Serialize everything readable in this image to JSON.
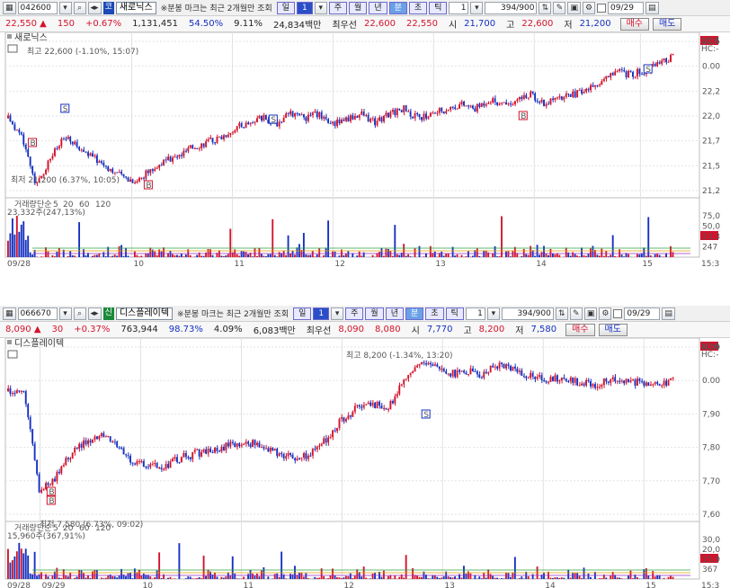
{
  "colors": {
    "up": "#d3132b",
    "down": "#1530c0",
    "grid": "#e2e2e2",
    "ma5": "#9a30c8",
    "ma20": "#e0a000",
    "ma60": "#2aa040",
    "ma120": "#888888"
  },
  "panels": [
    {
      "toolbar": {
        "code": "042600",
        "market_tag": "코",
        "name": "새로닉스",
        "note": "※분봉 마크는 최근 2개월만 조회",
        "periods": [
          "일",
          "1",
          "주",
          "월",
          "년",
          "분",
          "초",
          "틱"
        ],
        "interval": "1",
        "count": "394/900",
        "date": "09/29"
      },
      "quote": {
        "price": "22,550",
        "change": "150",
        "change_pct": "+0.67%",
        "volume": "1,131,451",
        "vol_ratio": "54.50%",
        "turnover": "9.11%",
        "amount": "24,834백만",
        "best_label": "최우선",
        "ask": "22,600",
        "bid": "22,550",
        "open_label": "시",
        "open": "21,700",
        "high_label": "고",
        "high": "22,600",
        "low_label": "저",
        "low": "21,200",
        "buy": "매수",
        "sell": "매도"
      },
      "chart_data": {
        "type": "candlestick",
        "stock_label": "새로닉스",
        "high_note": "최고 22,600 (-1.10%, 15:07)",
        "low_note": "최저 21,200 (6.37%, 10:05)",
        "price_ticks": [
          "22,5",
          "0.00",
          "22,2",
          "22,0",
          "21,7",
          "21,5",
          "21,2"
        ],
        "lc_label": "LC:6",
        "hc_label": "HC:-",
        "vol_legend": [
          "거래량",
          "단순",
          "5",
          "20",
          "60",
          "120"
        ],
        "vol_value": "23,332주(247,13%)",
        "vol_ticks": [
          "75,0",
          "50,0",
          "23,3",
          "247"
        ],
        "x_labels": [
          "09/28",
          "10",
          "11",
          "12",
          "13",
          "14",
          "15",
          "15:3"
        ],
        "path": [
          21900,
          21700,
          21200,
          21500,
          21700,
          21600,
          21500,
          21400,
          21300,
          21250,
          21350,
          21450,
          21500,
          21600,
          21650,
          21700,
          21800,
          21850,
          21900,
          21850,
          21950,
          21900,
          21950,
          21850,
          21900,
          21950,
          21850,
          21950,
          22000,
          21900,
          21950,
          22000,
          22050,
          22000,
          22100,
          22050,
          22100,
          22150,
          22050,
          22100,
          22150,
          22200,
          22300,
          22400,
          22350,
          22400,
          22450,
          22550
        ]
      }
    },
    {
      "toolbar": {
        "code": "066670",
        "market_tag": "신",
        "name": "디스플레이텍",
        "note": "※분봉 마크는 최근 2개월만 조회",
        "periods": [
          "일",
          "1",
          "주",
          "월",
          "년",
          "분",
          "초",
          "틱"
        ],
        "interval": "1",
        "count": "394/900",
        "date": "09/29"
      },
      "quote": {
        "price": "8,090",
        "change": "30",
        "change_pct": "+0.37%",
        "volume": "763,944",
        "vol_ratio": "98.73%",
        "turnover": "4.09%",
        "amount": "6,083백만",
        "best_label": "최우선",
        "ask": "8,090",
        "bid": "8,080",
        "open_label": "시",
        "open": "7,770",
        "high_label": "고",
        "high": "8,200",
        "low_label": "저",
        "low": "7,580",
        "buy": "매수",
        "sell": "매도"
      },
      "chart_data": {
        "type": "candlestick",
        "stock_label": "디스플레이텍",
        "high_note": "최고 8,200 (-1.34%, 13:20)",
        "low_note": "최저 7,580 (6.73%, 09:02)",
        "price_ticks": [
          "8,09",
          "0.00",
          "7,90",
          "7,80",
          "7,70",
          "7,60"
        ],
        "lc_label": "LC:6",
        "hc_label": "HC:-",
        "vol_legend": [
          "거래량",
          "단순",
          "5",
          "20",
          "60",
          "120"
        ],
        "vol_value": "15,960주(367,91%)",
        "vol_ticks": [
          "30,0",
          "20,0",
          "15,9",
          "367"
        ],
        "x_labels": [
          "09/28",
          "09/29",
          "10",
          "11",
          "12",
          "13",
          "14",
          "15",
          "15:3"
        ],
        "path": [
          8050,
          8050,
          7640,
          7700,
          7800,
          7850,
          7870,
          7820,
          7760,
          7740,
          7750,
          7780,
          7800,
          7810,
          7830,
          7840,
          7830,
          7800,
          7780,
          7790,
          7850,
          7930,
          7980,
          8000,
          7980,
          8100,
          8160,
          8150,
          8120,
          8130,
          8120,
          8160,
          8140,
          8110,
          8100,
          8100,
          8090,
          8080,
          8090,
          8100,
          8080,
          8070,
          8090
        ]
      }
    }
  ]
}
